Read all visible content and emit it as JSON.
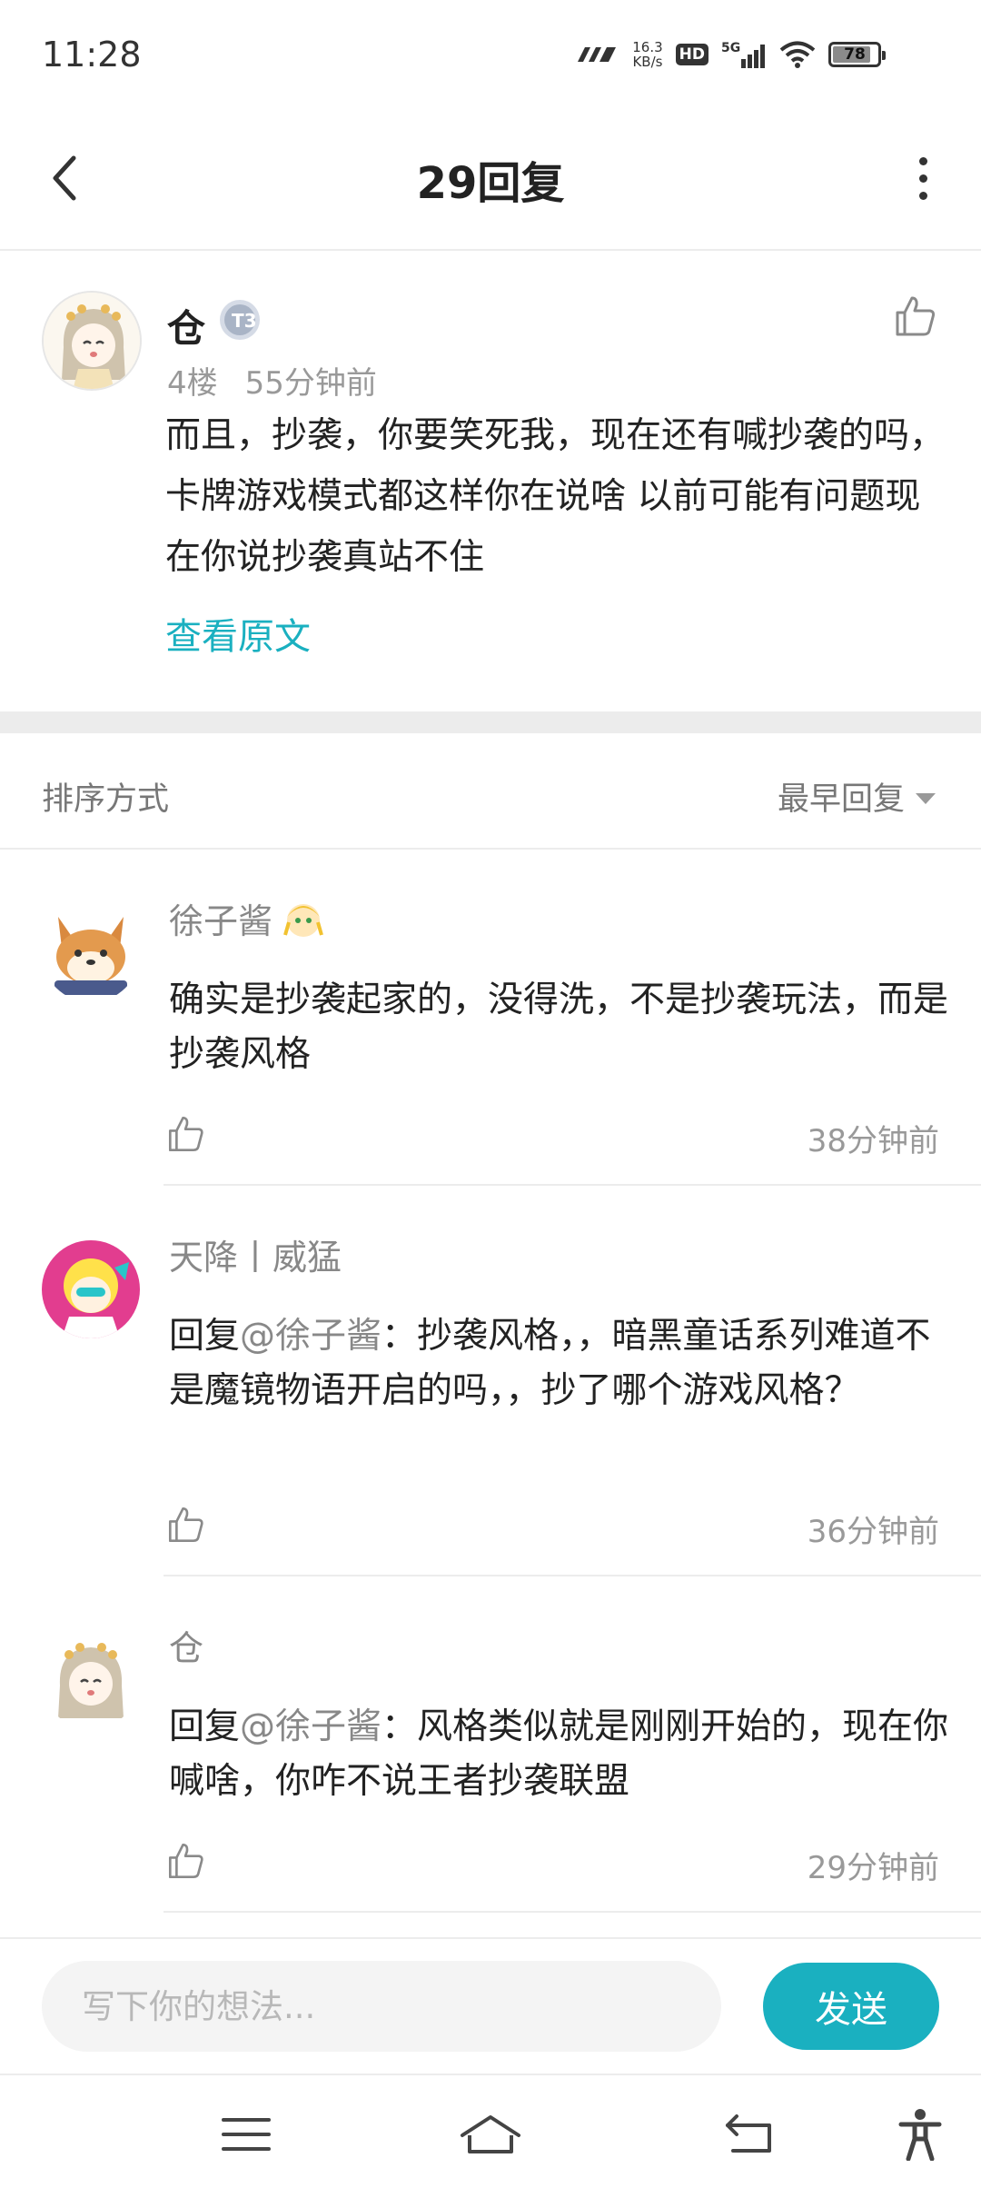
{
  "status_bar": {
    "time": "11:28",
    "net_speed_value": "16.3",
    "net_speed_unit": "KB/s",
    "hd_label": "HD",
    "network_type": "5G",
    "battery_level": "78"
  },
  "header": {
    "title": "29回复"
  },
  "post": {
    "author": "仓",
    "level_badge": "T3",
    "floor": "4楼",
    "time": "55分钟前",
    "body": "而且，抄袭，你要笑死我，现在还有喊抄袭的吗，卡牌游戏模式都这样你在说啥 以前可能有问题现在你说抄袭真站不住",
    "view_original_label": "查看原文"
  },
  "sort": {
    "label": "排序方式",
    "selected": "最早回复"
  },
  "replies": [
    {
      "name": "徐子酱",
      "prefix": "",
      "mention": "",
      "text": "确实是抄袭起家的，没得洗，不是抄袭玩法，而是抄袭风格",
      "time": "38分钟前"
    },
    {
      "name": "天降丨威猛",
      "prefix": "回复",
      "mention": "@徐子酱",
      "text": "：抄袭风格，，暗黑童话系列难道不是魔镜物语开启的吗，，抄了哪个游戏风格？",
      "time": "36分钟前"
    },
    {
      "name": "仓",
      "prefix": "回复",
      "mention": "@徐子酱",
      "text": "：风格类似就是刚刚开始的，现在你喊啥，你咋不说王者抄袭联盟",
      "time": "29分钟前"
    }
  ],
  "composer": {
    "placeholder": "写下你的想法...",
    "send_label": "发送"
  },
  "colors": {
    "accent": "#1ab0c0",
    "divider": "#ececec",
    "muted_text": "#999999"
  }
}
